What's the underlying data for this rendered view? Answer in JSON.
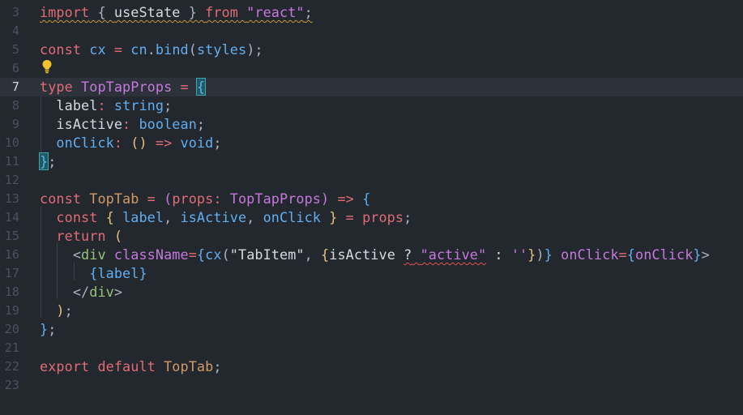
{
  "editor": {
    "lines": [
      {
        "num": "3",
        "tokens": [
          {
            "t": "import",
            "c": "c-keyword",
            "u": "warn"
          },
          {
            "t": " { ",
            "c": "c-punct",
            "u": "warn"
          },
          {
            "t": "useState",
            "c": "c-white",
            "u": "warn"
          },
          {
            "t": " } ",
            "c": "c-punct",
            "u": "warn"
          },
          {
            "t": "from",
            "c": "c-keyword",
            "u": "warn"
          },
          {
            "t": " ",
            "c": "c-punct",
            "u": "warn"
          },
          {
            "t": "\"react\"",
            "c": "c-str2",
            "u": "warn"
          },
          {
            "t": ";",
            "c": "c-punct",
            "u": "warn"
          }
        ]
      },
      {
        "num": "4",
        "tokens": []
      },
      {
        "num": "5",
        "tokens": [
          {
            "t": "const ",
            "c": "c-keyword"
          },
          {
            "t": "cx",
            "c": "c-prop"
          },
          {
            "t": " = ",
            "c": "c-op"
          },
          {
            "t": "cn",
            "c": "c-fn"
          },
          {
            "t": ".",
            "c": "c-punct"
          },
          {
            "t": "bind",
            "c": "c-fn"
          },
          {
            "t": "(",
            "c": "c-punct"
          },
          {
            "t": "styles",
            "c": "c-prop"
          },
          {
            "t": ");",
            "c": "c-punct"
          }
        ]
      },
      {
        "num": "6",
        "tokens": []
      },
      {
        "num": "7",
        "current": true,
        "tokens": [
          {
            "t": "type ",
            "c": "c-keyword"
          },
          {
            "t": "TopTapProps",
            "c": "c-type"
          },
          {
            "t": " = ",
            "c": "c-op"
          },
          {
            "t": "{",
            "c": "c-brace3",
            "hl": true
          }
        ]
      },
      {
        "num": "8",
        "tokens": [
          {
            "t": "  label",
            "c": "c-white"
          },
          {
            "t": ": ",
            "c": "c-op"
          },
          {
            "t": "string",
            "c": "c-prim"
          },
          {
            "t": ";",
            "c": "c-punct"
          }
        ]
      },
      {
        "num": "9",
        "tokens": [
          {
            "t": "  isActive",
            "c": "c-white"
          },
          {
            "t": ": ",
            "c": "c-op"
          },
          {
            "t": "boolean",
            "c": "c-prim"
          },
          {
            "t": ";",
            "c": "c-punct"
          }
        ]
      },
      {
        "num": "10",
        "tokens": [
          {
            "t": "  onClick",
            "c": "c-fn"
          },
          {
            "t": ": ",
            "c": "c-op"
          },
          {
            "t": "() ",
            "c": "c-brace"
          },
          {
            "t": "=>",
            "c": "c-arrow"
          },
          {
            "t": " void",
            "c": "c-prim"
          },
          {
            "t": ";",
            "c": "c-punct"
          }
        ]
      },
      {
        "num": "11",
        "tokens": [
          {
            "t": "}",
            "c": "c-brace3",
            "hl": true
          },
          {
            "t": ";",
            "c": "c-punct"
          }
        ]
      },
      {
        "num": "12",
        "tokens": []
      },
      {
        "num": "13",
        "tokens": [
          {
            "t": "const ",
            "c": "c-keyword"
          },
          {
            "t": "TopTab",
            "c": "c-orange"
          },
          {
            "t": " = ",
            "c": "c-op"
          },
          {
            "t": "(",
            "c": "c-brace2"
          },
          {
            "t": "props",
            "c": "c-param"
          },
          {
            "t": ": ",
            "c": "c-op"
          },
          {
            "t": "TopTapProps",
            "c": "c-type"
          },
          {
            "t": ")",
            "c": "c-brace2"
          },
          {
            "t": " => ",
            "c": "c-arrow"
          },
          {
            "t": "{",
            "c": "c-brace3"
          }
        ]
      },
      {
        "num": "14",
        "tokens": [
          {
            "t": "  const ",
            "c": "c-keyword"
          },
          {
            "t": "{ ",
            "c": "c-brace"
          },
          {
            "t": "label",
            "c": "c-prop"
          },
          {
            "t": ", ",
            "c": "c-punct"
          },
          {
            "t": "isActive",
            "c": "c-prop"
          },
          {
            "t": ", ",
            "c": "c-punct"
          },
          {
            "t": "onClick",
            "c": "c-prop"
          },
          {
            "t": " }",
            "c": "c-brace"
          },
          {
            "t": " = ",
            "c": "c-op"
          },
          {
            "t": "props",
            "c": "c-param"
          },
          {
            "t": ";",
            "c": "c-punct"
          }
        ]
      },
      {
        "num": "15",
        "tokens": [
          {
            "t": "  return ",
            "c": "c-keyword"
          },
          {
            "t": "(",
            "c": "c-brace"
          }
        ]
      },
      {
        "num": "16",
        "tokens": [
          {
            "t": "    <",
            "c": "c-punct"
          },
          {
            "t": "div",
            "c": "c-tag"
          },
          {
            "t": " className",
            "c": "c-attr"
          },
          {
            "t": "=",
            "c": "c-op"
          },
          {
            "t": "{",
            "c": "c-brace3"
          },
          {
            "t": "cx",
            "c": "c-fn"
          },
          {
            "t": "(",
            "c": "c-punct"
          },
          {
            "t": "\"TabItem\"",
            "c": "c-white"
          },
          {
            "t": ", ",
            "c": "c-punct"
          },
          {
            "t": "{",
            "c": "c-brace"
          },
          {
            "t": "isActive",
            "c": "c-white"
          },
          {
            "t": " ",
            "c": "c-punct"
          },
          {
            "t": "?",
            "c": "c-white",
            "u": "err"
          },
          {
            "t": " ",
            "c": "c-punct",
            "u": "err"
          },
          {
            "t": "\"active\"",
            "c": "c-str2",
            "u": "err"
          },
          {
            "t": " : ",
            "c": "c-white"
          },
          {
            "t": "''",
            "c": "c-str2"
          },
          {
            "t": "}",
            "c": "c-brace"
          },
          {
            "t": ")",
            "c": "c-punct"
          },
          {
            "t": "}",
            "c": "c-brace3"
          },
          {
            "t": " onClick",
            "c": "c-attr"
          },
          {
            "t": "=",
            "c": "c-op"
          },
          {
            "t": "{",
            "c": "c-brace3"
          },
          {
            "t": "onClick",
            "c": "c-attr"
          },
          {
            "t": "}",
            "c": "c-brace3"
          },
          {
            "t": ">",
            "c": "c-punct"
          }
        ]
      },
      {
        "num": "17",
        "tokens": [
          {
            "t": "      {",
            "c": "c-brace3"
          },
          {
            "t": "label",
            "c": "c-prop"
          },
          {
            "t": "}",
            "c": "c-brace3"
          }
        ]
      },
      {
        "num": "18",
        "tokens": [
          {
            "t": "    </",
            "c": "c-punct"
          },
          {
            "t": "div",
            "c": "c-tag"
          },
          {
            "t": ">",
            "c": "c-punct"
          }
        ]
      },
      {
        "num": "19",
        "tokens": [
          {
            "t": "  )",
            "c": "c-brace"
          },
          {
            "t": ";",
            "c": "c-punct"
          }
        ]
      },
      {
        "num": "20",
        "tokens": [
          {
            "t": "}",
            "c": "c-brace3"
          },
          {
            "t": ";",
            "c": "c-punct"
          }
        ]
      },
      {
        "num": "21",
        "tokens": []
      },
      {
        "num": "22",
        "tokens": [
          {
            "t": "export ",
            "c": "c-keyword"
          },
          {
            "t": "default ",
            "c": "c-keyword"
          },
          {
            "t": "TopTab",
            "c": "c-orange"
          },
          {
            "t": ";",
            "c": "c-punct"
          }
        ]
      },
      {
        "num": "23",
        "tokens": []
      }
    ],
    "lightbulb_icon": "lightbulb-icon",
    "colors": {
      "background": "#23272e",
      "current_line": "#2c313a",
      "warning_underline": "#c29a36",
      "error_underline": "#e05252",
      "lightbulb": "#f2c32c"
    }
  }
}
